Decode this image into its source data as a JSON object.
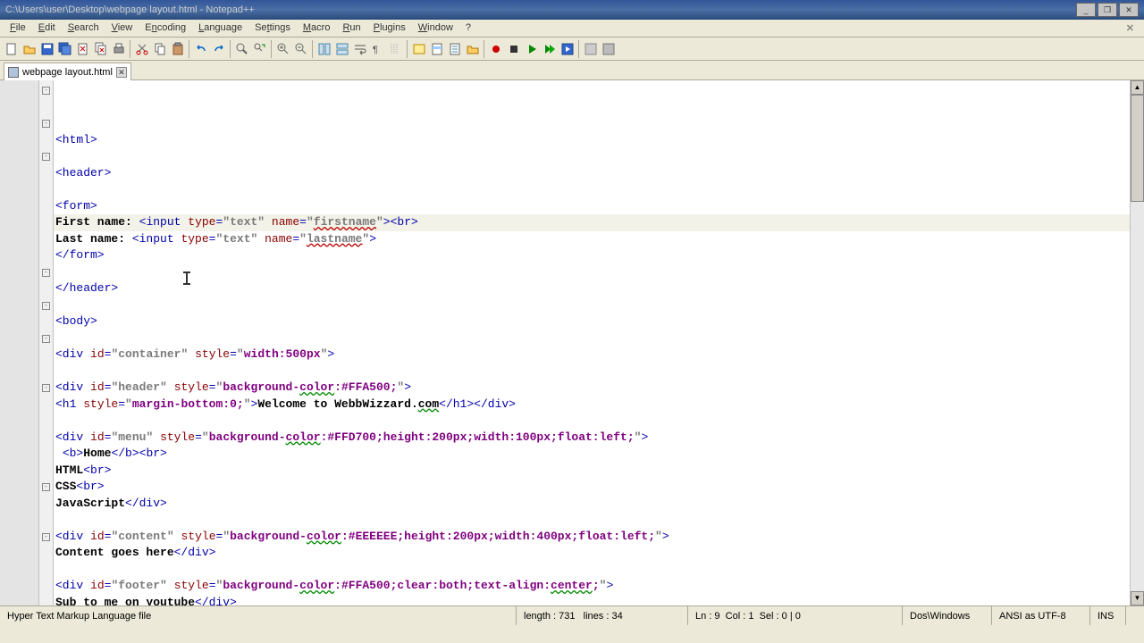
{
  "window": {
    "title": "C:\\Users\\user\\Desktop\\webpage layout.html - Notepad++"
  },
  "menubar": {
    "file": "File",
    "edit": "Edit",
    "search": "Search",
    "view": "View",
    "encoding": "Encoding",
    "language": "Language",
    "settings": "Settings",
    "macro": "Macro",
    "run": "Run",
    "plugins": "Plugins",
    "window": "Window",
    "help": "?"
  },
  "tab": {
    "label": "webpage layout.html"
  },
  "code": {
    "l1_tag_open": "<html>",
    "l2": "",
    "l3_tag": "<header>",
    "l4": "",
    "l5_tag": "<form>",
    "l6_label": "First name:",
    "l6_t1": " <",
    "l6_input": "input",
    "l6_sp": " ",
    "l6_type": "type",
    "l6_eq": "=",
    "l6_typev": "\"text\"",
    "l6_name": "name",
    "l6_namev": "\"firstname\"",
    "l6_close": "><",
    "l6_br": "br",
    "l6_end": ">",
    "l7_label": "Last name:",
    "l7_t1": " <",
    "l7_namev": "\"lastname\"",
    "l7_close": ">",
    "l8_tag": "</form>",
    "l9": "",
    "l10_tag": "</header>",
    "l11": "",
    "l12_tag": "<body>",
    "l13": "",
    "l14_open": "<",
    "l14_div": "div",
    "l14_id": "id",
    "l14_idv": "\"container\"",
    "l14_style": "style",
    "l14_stylev": "\"width:500px\"",
    "l14_close": ">",
    "l15": "",
    "l16_idv": "\"header\"",
    "l16_stylev": "\"background-color:#FFA500;\"",
    "l17_open": "<",
    "l17_h1": "h1",
    "l17_stylev": "\"margin-bottom:0;\"",
    "l17_text": "Welcome to WebbWizzard.com",
    "l17_close1": "</",
    "l17_close2": "></",
    "l17_closediv": ">",
    "l18": "",
    "l19_idv": "\"menu\"",
    "l19_stylev": "\"background-color:#FFD700;height:200px;width:100px;float:left;\"",
    "l20_t1": " <",
    "l20_b": "b",
    "l20_home": "Home",
    "l20_cb": "</",
    "l20_br": "br",
    "l21_html": "HTML",
    "l22_css": "CSS",
    "l23_js": "JavaScript",
    "l23_close": "</",
    "l24": "",
    "l25_idv": "\"content\"",
    "l25_stylev": "\"background-color:#EEEEEE;height:200px;width:400px;float:left;\"",
    "l26_text": "Content goes here",
    "l27": "",
    "l28_idv": "\"footer\"",
    "l28_stylev": "\"background-color:#FFA500;clear:both;text-align:center;\"",
    "l29_text": "Sub to me on youtube"
  },
  "statusbar": {
    "filetype": "Hyper Text Markup Language file",
    "length": "length : 731",
    "lines": "lines : 34",
    "ln": "Ln : 9",
    "col": "Col : 1",
    "sel": "Sel : 0 | 0",
    "eol": "Dos\\Windows",
    "enc": "ANSI as UTF-8",
    "ins": "INS"
  },
  "icons": {
    "new": "new-file",
    "open": "open-file",
    "save": "save",
    "saveall": "save-all",
    "close": "close",
    "closeall": "close-all",
    "print": "print",
    "cut": "cut",
    "copy": "copy",
    "paste": "paste",
    "undo": "undo",
    "redo": "redo",
    "find": "find",
    "replace": "replace",
    "zoomin": "zoom-in",
    "zoomout": "zoom-out",
    "sync": "sync",
    "wrap": "word-wrap",
    "allchars": "show-all-chars",
    "indent": "indent-guide",
    "udl": "user-lang",
    "folder": "folder-workspace",
    "funclist": "function-list",
    "rec": "record-macro",
    "play": "play-macro",
    "playm": "play-multi",
    "savemac": "save-macro"
  }
}
